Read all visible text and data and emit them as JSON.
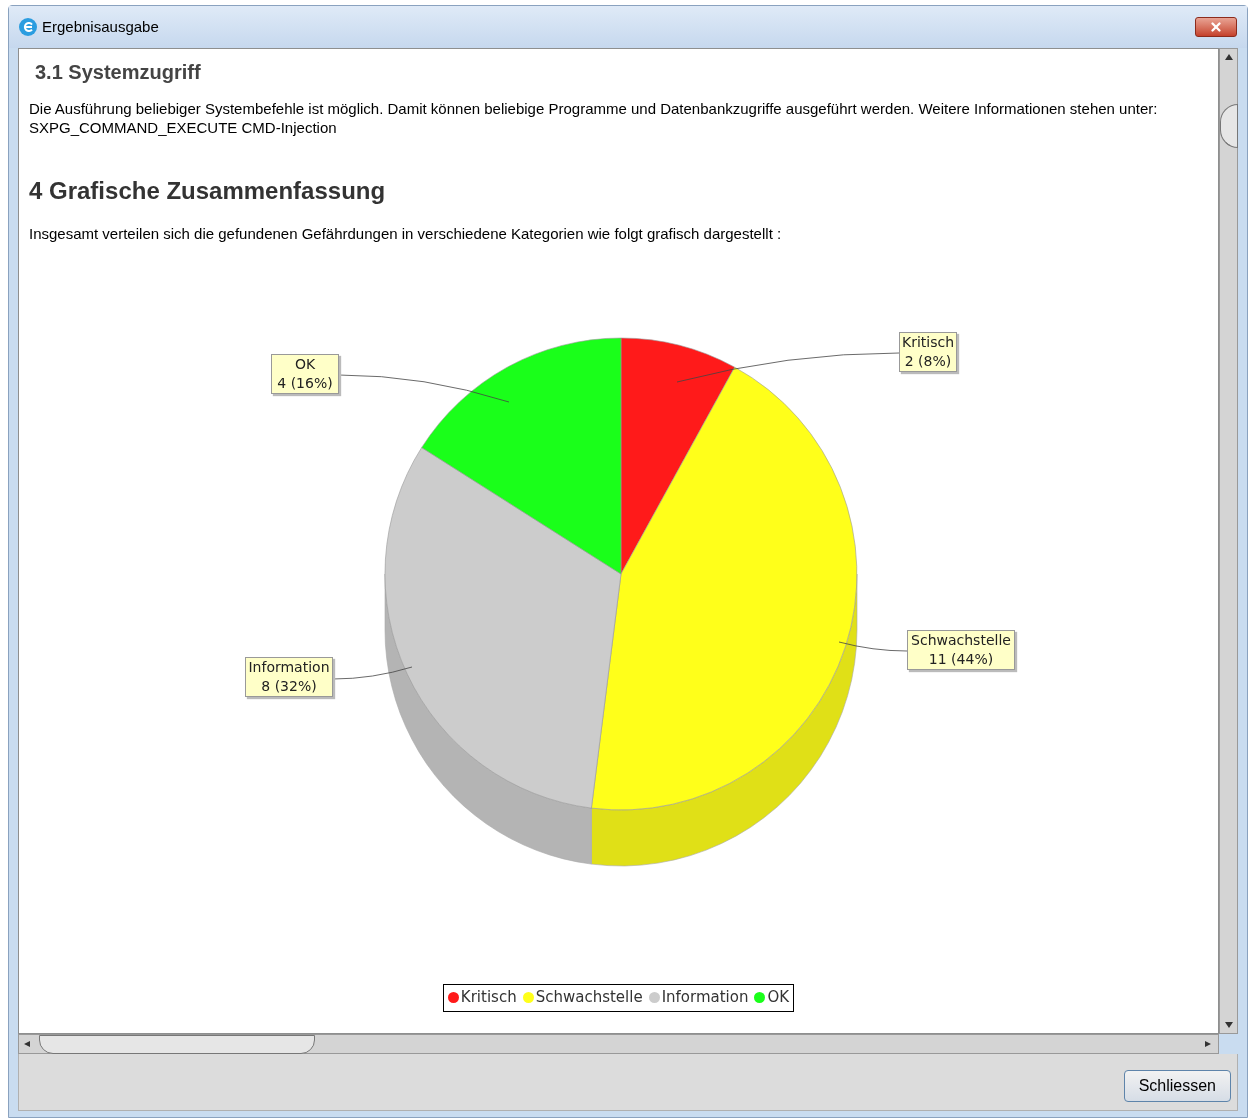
{
  "window": {
    "title": "Ergebnisausgabe"
  },
  "section_3_1": {
    "heading": "3.1 Systemzugriff",
    "text": "Die Ausführung beliebiger Systembefehle ist möglich. Damit können beliebige Programme und Datenbankzugriffe ausgeführt werden. Weitere Informationen stehen unter: SXPG_COMMAND_EXECUTE CMD-Injection"
  },
  "section_4": {
    "heading": "4 Grafische Zusammenfassung",
    "text": "Insgesamt verteilen sich die gefundenen Gefährdungen in verschiedene Kategorien wie folgt grafisch dargestellt :",
    "chart_data": {
      "type": "pie",
      "categories": [
        "Kritisch",
        "Schwachstelle",
        "Information",
        "OK"
      ],
      "values": [
        2,
        11,
        8,
        4
      ],
      "colors": [
        "#ff1a1a",
        "#ffff1a",
        "#cccccc",
        "#1aff1a"
      ],
      "value_labels": [
        "2 (8%)",
        "11 (44%)",
        "8 (32%)",
        "4 (16%)"
      ]
    }
  },
  "buttons": [
    "Schliessen"
  ]
}
